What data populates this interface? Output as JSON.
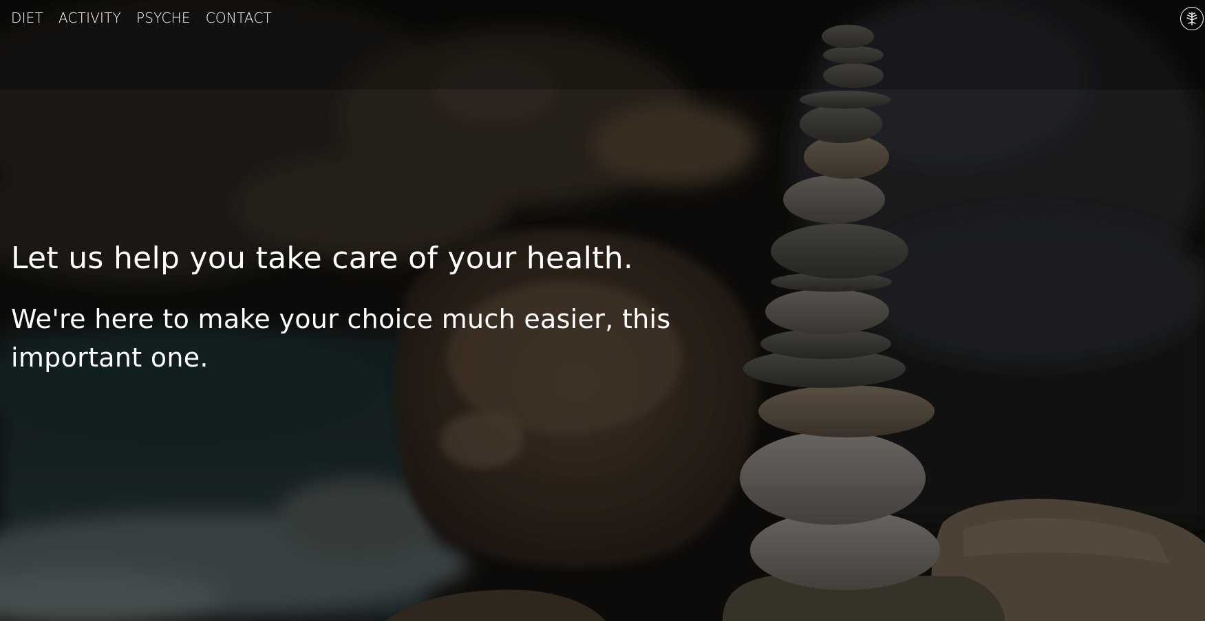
{
  "nav": {
    "items": [
      {
        "label": "DIET"
      },
      {
        "label": "ACTIVITY"
      },
      {
        "label": "PSYCHE"
      },
      {
        "label": "CONTACT"
      }
    ]
  },
  "logo": {
    "icon": "snowflake-tree-icon"
  },
  "hero": {
    "headline": "Let us help you take care of your health.",
    "subline": "We're here to make your choice much easier, this important one.",
    "background": "stacked-stones-river-photo"
  },
  "colors": {
    "text": "#ffffff",
    "overlay": "#000000"
  }
}
